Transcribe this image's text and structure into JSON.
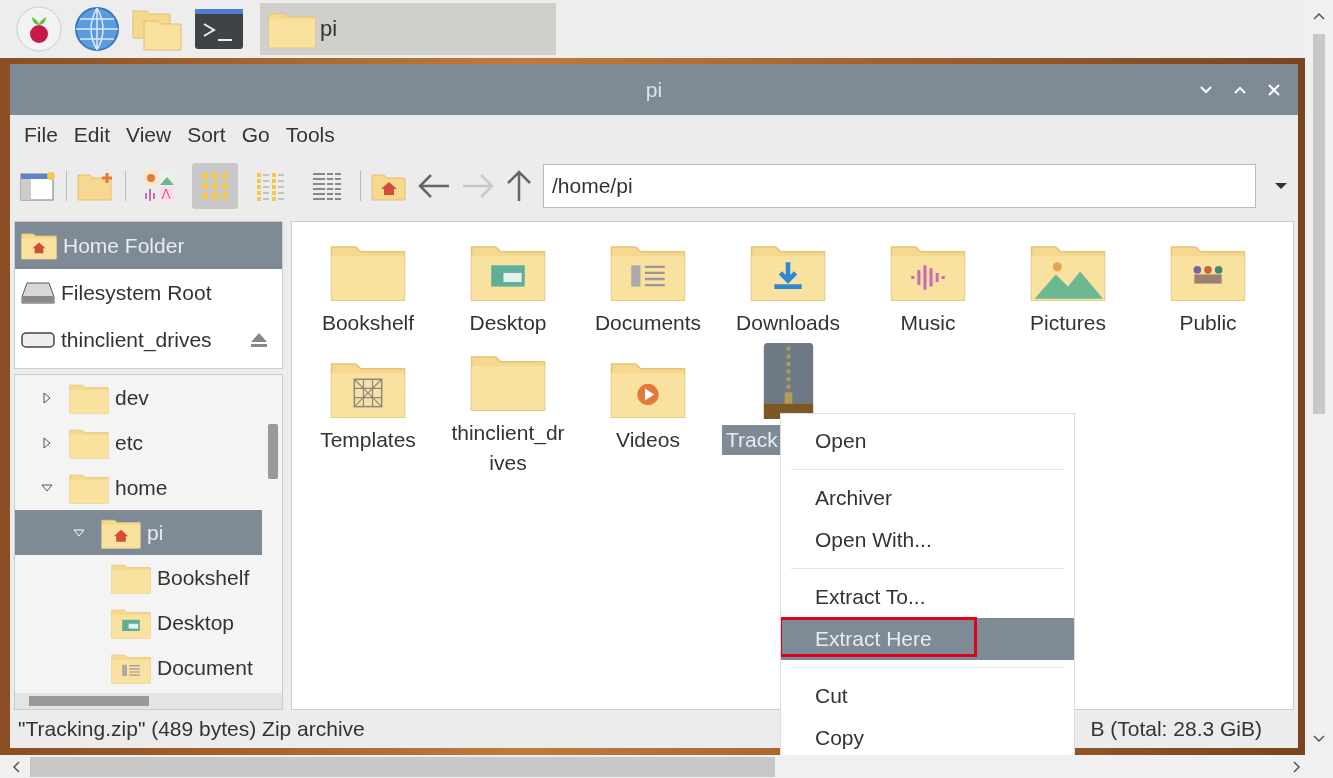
{
  "taskbar": {
    "launchers": [
      {
        "kind": "raspberry"
      },
      {
        "kind": "globe"
      },
      {
        "kind": "folders"
      },
      {
        "kind": "terminal"
      }
    ],
    "task": {
      "label": "pi",
      "selected": true
    }
  },
  "window": {
    "title": "pi"
  },
  "menu": [
    "File",
    "Edit",
    "View",
    "Sort",
    "Go",
    "Tools"
  ],
  "toolbar": {
    "view_modes": [
      {
        "kind": "thumbnail",
        "selected": false
      },
      {
        "kind": "icon",
        "selected": true
      },
      {
        "kind": "compact",
        "selected": false
      },
      {
        "kind": "list",
        "selected": false
      }
    ],
    "forward_disabled": true,
    "path": "/home/pi"
  },
  "places": [
    {
      "label": "Home Folder",
      "kind": "home",
      "selected": true
    },
    {
      "label": "Filesystem Root",
      "kind": "disk",
      "selected": false
    },
    {
      "label": "thinclient_drives",
      "kind": "drive",
      "selected": false
    }
  ],
  "tree": [
    {
      "label": "dev",
      "kind": "folder",
      "expanded": false,
      "selected": false
    },
    {
      "label": "etc",
      "kind": "folder",
      "expanded": false,
      "selected": false
    },
    {
      "label": "home",
      "kind": "folder",
      "expanded": true,
      "selected": false,
      "children": [
        {
          "label": "pi",
          "kind": "home",
          "expanded": true,
          "selected": true,
          "children": [
            {
              "label": "Bookshelf",
              "kind": "folder",
              "selected": false
            },
            {
              "label": "Desktop",
              "kind": "desktop",
              "selected": false
            },
            {
              "label": "Document",
              "kind": "documents",
              "selected": false
            }
          ]
        }
      ]
    }
  ],
  "files": [
    {
      "name": "Bookshelf",
      "kind": "folder",
      "selected": false
    },
    {
      "name": "Desktop",
      "kind": "desktop",
      "selected": false
    },
    {
      "name": "Documents",
      "kind": "documents",
      "selected": false
    },
    {
      "name": "Downloads",
      "kind": "downloads",
      "selected": false
    },
    {
      "name": "Music",
      "kind": "music",
      "selected": false
    },
    {
      "name": "Pictures",
      "kind": "pictures",
      "selected": false
    },
    {
      "name": "Public",
      "kind": "public",
      "selected": false
    },
    {
      "name": "Templates",
      "kind": "templates",
      "selected": false
    },
    {
      "name": "thinclient_dr ives",
      "kind": "folder",
      "selected": false
    },
    {
      "name": "Videos",
      "kind": "videos",
      "selected": false
    },
    {
      "name": "Track",
      "kind": "zip",
      "selected": true
    }
  ],
  "context_menu": [
    [
      {
        "label": "Open",
        "selected": false,
        "outlined": false
      }
    ],
    [
      {
        "label": "Archiver",
        "selected": false,
        "outlined": false
      },
      {
        "label": "Open With...",
        "selected": false,
        "outlined": false
      }
    ],
    [
      {
        "label": "Extract To...",
        "selected": false,
        "outlined": false
      },
      {
        "label": "Extract Here",
        "selected": true,
        "outlined": true
      }
    ],
    [
      {
        "label": "Cut",
        "selected": false,
        "outlined": false
      },
      {
        "label": "Copy",
        "selected": false,
        "outlined": false
      }
    ]
  ],
  "status_bar": {
    "selection": "\"Tracking.zip\" (489 bytes) Zip archive",
    "free_space": "B (Total: 28.3 GiB)"
  }
}
